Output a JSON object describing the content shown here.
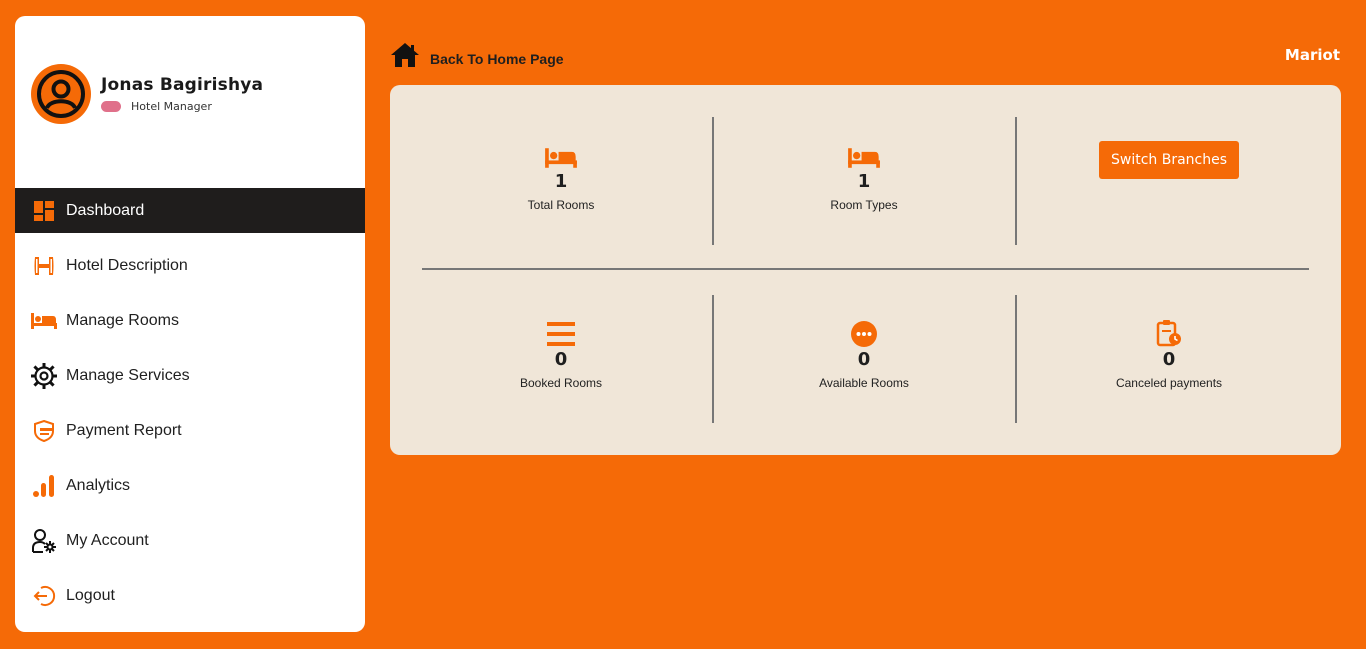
{
  "profile": {
    "name": "Jonas Bagirishya",
    "role": "Hotel Manager"
  },
  "sidebar": {
    "items": [
      {
        "label": "Dashboard",
        "icon": "dashboard-icon",
        "active": true
      },
      {
        "label": "Hotel Description",
        "icon": "hotel-icon"
      },
      {
        "label": "Manage Rooms",
        "icon": "bed-icon"
      },
      {
        "label": "Manage Services",
        "icon": "gear-icon"
      },
      {
        "label": "Payment Report",
        "icon": "payment-report-icon"
      },
      {
        "label": "Analytics",
        "icon": "analytics-icon"
      },
      {
        "label": "My Account",
        "icon": "user-settings-icon"
      },
      {
        "label": "Logout",
        "icon": "logout-icon"
      }
    ]
  },
  "header": {
    "back_label": "Back To Home Page",
    "brand": "Mariot"
  },
  "stats": {
    "total_rooms": {
      "value": "1",
      "label": "Total Rooms"
    },
    "room_types": {
      "value": "1",
      "label": "Room Types"
    },
    "booked_rooms": {
      "value": "0",
      "label": "Booked Rooms"
    },
    "available_rooms": {
      "value": "0",
      "label": "Available Rooms"
    },
    "canceled_payments": {
      "value": "0",
      "label": "Canceled payments"
    }
  },
  "actions": {
    "switch_branches": "Switch Branches"
  },
  "colors": {
    "accent": "#f56a07",
    "panel": "#f0e6d8",
    "active_nav": "#1f1d1c",
    "role_pill": "#e0708a"
  }
}
